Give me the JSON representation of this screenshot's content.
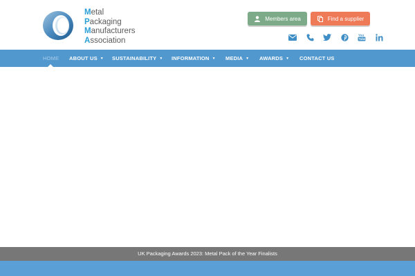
{
  "logo": {
    "lines": [
      {
        "cap": "M",
        "rest": "etal"
      },
      {
        "cap": "P",
        "rest": "ackaging"
      },
      {
        "cap": "M",
        "rest": "anufacturers"
      },
      {
        "cap": "A",
        "rest": "ssociation"
      }
    ]
  },
  "header": {
    "members_label": "Members area",
    "supplier_label": "Find a supplier",
    "social_icons": [
      "envelope-icon",
      "phone-icon",
      "twitter-icon",
      "pinterest-icon",
      "youtube-icon",
      "linkedin-icon"
    ]
  },
  "nav": {
    "items": [
      {
        "label": "HOME",
        "has_dropdown": false
      },
      {
        "label": "ABOUT US",
        "has_dropdown": true
      },
      {
        "label": "SUSTAINABILITY",
        "has_dropdown": true
      },
      {
        "label": "INFORMATION",
        "has_dropdown": true
      },
      {
        "label": "MEDIA",
        "has_dropdown": true
      },
      {
        "label": "AWARDS",
        "has_dropdown": true
      },
      {
        "label": "CONTACT US",
        "has_dropdown": false
      }
    ]
  },
  "ticker": {
    "text": "UK Packaging Awards 2023: Metal Pack of the Year Finalists"
  },
  "colors": {
    "nav_bg": "#5198cf",
    "members_btn": "#7daa88",
    "supplier_btn": "#ee7a58",
    "ticker_bg": "#777777",
    "footer_bg": "#5aa0d6",
    "accent": "#2a9fd6"
  }
}
